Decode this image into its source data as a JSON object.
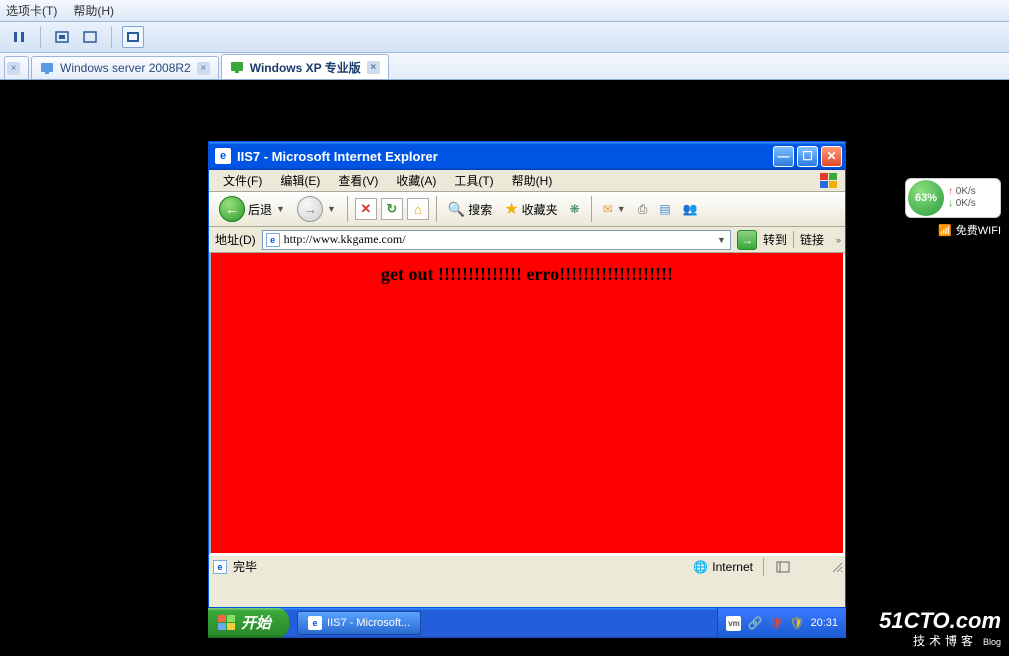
{
  "host": {
    "menu": {
      "tabs": "选项卡(T)",
      "help": "帮助(H)"
    }
  },
  "tabs": [
    {
      "label": "Windows server 2008R2"
    },
    {
      "label": "Windows XP 专业版"
    }
  ],
  "ie": {
    "title": "IIS7 - Microsoft Internet Explorer",
    "menu": {
      "file": "文件(F)",
      "edit": "编辑(E)",
      "view": "查看(V)",
      "fav": "收藏(A)",
      "tools": "工具(T)",
      "help": "帮助(H)"
    },
    "toolbar": {
      "back": "后退",
      "search": "搜索",
      "favorites": "收藏夹"
    },
    "addr_label": "地址(D)",
    "url": "http://www.kkgame.com/",
    "go": "转到",
    "links": "链接",
    "page_text": "get out !!!!!!!!!!!!!! erro!!!!!!!!!!!!!!!!!!!",
    "status_done": "完毕",
    "status_zone": "Internet"
  },
  "xp": {
    "start": "开始",
    "task": "IIS7 - Microsoft...",
    "clock": "20:31"
  },
  "net": {
    "pct": "63%",
    "up": "0K/s",
    "down": "0K/s",
    "wifi": "免费WIFI"
  },
  "watermark": {
    "brand": "51CTO.com",
    "sub": "技术博客",
    "blog": "Blog"
  }
}
